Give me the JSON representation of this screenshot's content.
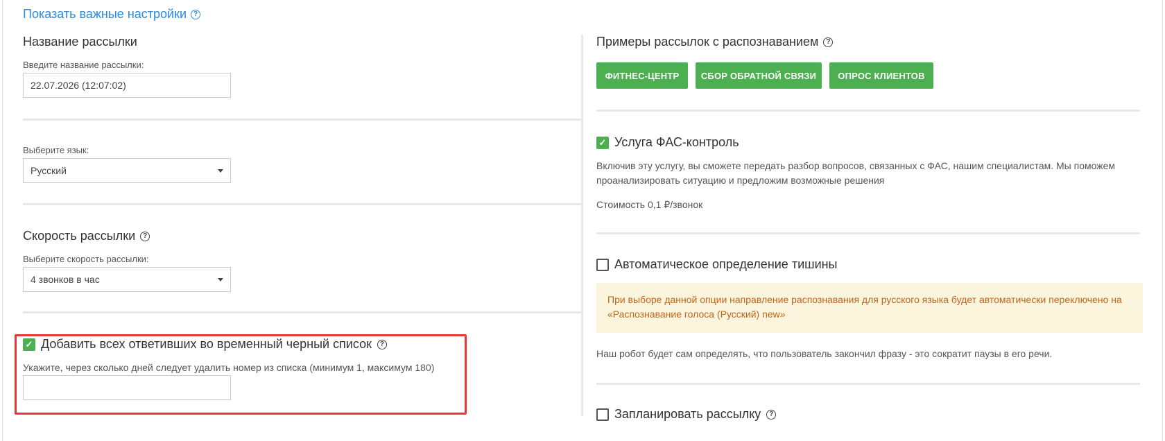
{
  "header": {
    "show_settings_label": "Показать важные настройки",
    "help_icon": "question-circle-icon"
  },
  "left": {
    "name_section": {
      "title": "Название рассылки",
      "label": "Введите название рассылки:",
      "value": "22.07.2026 (12:07:02)"
    },
    "language": {
      "label": "Выберите язык:",
      "selected": "Русский"
    },
    "speed": {
      "title": "Скорость рассылки",
      "label": "Выберите скорость рассылки:",
      "selected": "4 звонков в час"
    },
    "blacklist": {
      "checked": true,
      "title": "Добавить всех ответивших во временный черный список",
      "label": "Укажите, через сколько дней следует удалить номер из списка (минимум 1, максимум 180)",
      "value": ""
    }
  },
  "right": {
    "examples": {
      "title": "Примеры рассылок с распознаванием",
      "buttons": [
        "Фитнес-центр",
        "Сбор обратной связи",
        "Опрос клиентов"
      ]
    },
    "fas": {
      "checked": true,
      "title": "Услуга ФАС-контроль",
      "description": "Включив эту услугу, вы сможете передать разбор вопросов, связанных с ФАС, нашим специалистам. Мы поможем проанализировать ситуацию и предложим возможные решения",
      "price": "Стоимость 0,1 ₽/звонок"
    },
    "silence": {
      "checked": false,
      "title": "Автоматическое определение тишины",
      "warning": "При выборе данной опции направление распознавания для русского языка будет автоматически переключено на «Распознавание голоса (Русский) new»",
      "description": "Наш робот будет сам определять, что пользователь закончил фразу - это сократит паузы в его речи."
    },
    "schedule": {
      "checked": false,
      "title": "Запланировать рассылку"
    }
  },
  "colors": {
    "accent_link": "#2a8ae0",
    "green": "#4caf50",
    "warning_bg": "#fcf5dd",
    "warning_text": "#c0651b",
    "highlight": "#e53935"
  }
}
